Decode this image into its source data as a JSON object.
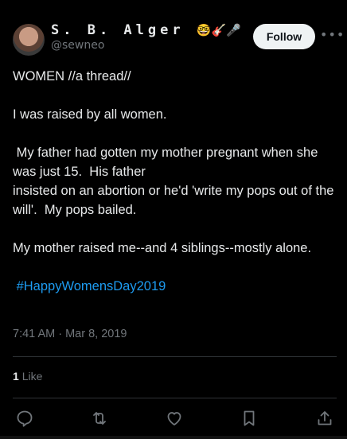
{
  "user": {
    "display_name": "S. B. Alger",
    "emojis": "🤓🎸🎤",
    "handle": "@sewneo"
  },
  "follow_label": "Follow",
  "more_label": "•••",
  "tweet": {
    "lines": [
      "WOMEN //a thread//",
      "I was raised by all women.",
      " My father had gotten my mother pregnant when she was just 15.  His father\ninsisted on an abortion or he'd 'write my pops out of the will'.  My pops bailed.",
      "My mother raised me--and 4 siblings--mostly alone."
    ],
    "hashtag": "#HappyWomensDay2019"
  },
  "timestamp": "7:41 AM · Mar 8, 2019",
  "likes": {
    "count": "1",
    "label": "Like"
  },
  "actions": [
    "reply-icon",
    "retweet-icon",
    "like-icon",
    "bookmark-icon",
    "share-icon"
  ],
  "colors": {
    "accent": "#1d9bf0",
    "muted": "#71767b",
    "text": "#e7e9ea",
    "background": "#000000"
  }
}
